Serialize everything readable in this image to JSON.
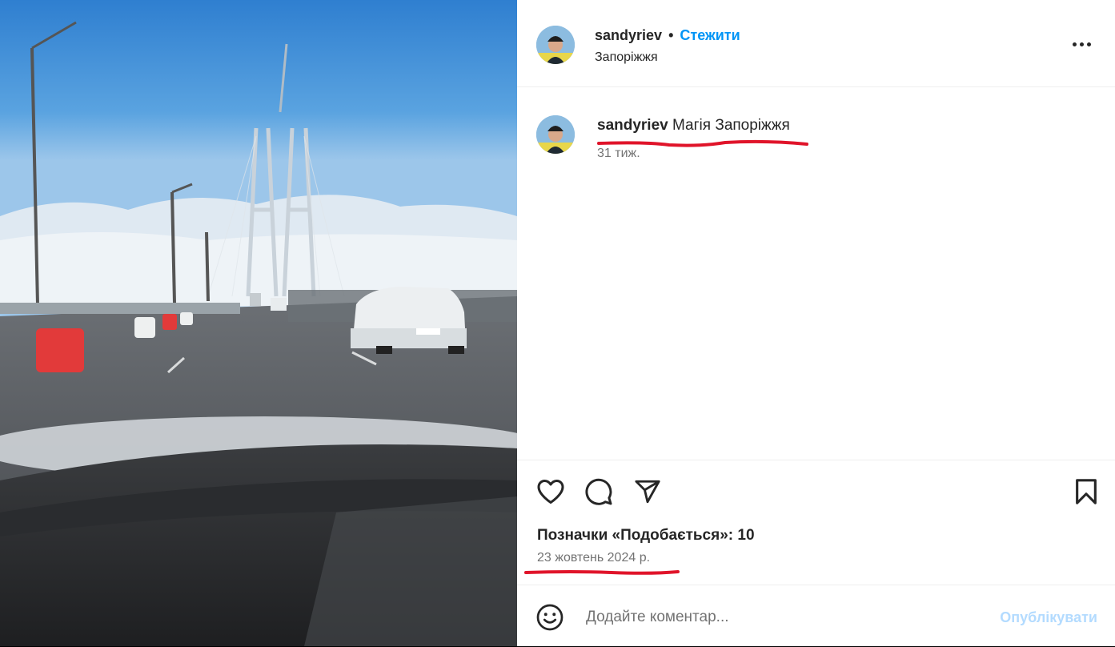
{
  "post": {
    "username": "sandyriev",
    "dot": "•",
    "follow_label": "Стежити",
    "location": "Запоріжжя",
    "caption_text": "Магія Запоріжжя",
    "caption_time": "31 тиж.",
    "likes_text": "Позначки «Подобається»: 10",
    "date_text": "23 жовтень 2024 р."
  },
  "comment": {
    "placeholder": "Додайте коментар...",
    "publish_label": "Опублікувати"
  },
  "icons": [
    "more-options-icon",
    "heart-icon",
    "comment-icon",
    "share-icon",
    "bookmark-icon",
    "emoji-icon"
  ],
  "colors": {
    "accent": "#0095f6",
    "publish_disabled": "#b3dbff",
    "annotation_underline": "#e0142a",
    "muted_text": "#737373"
  }
}
